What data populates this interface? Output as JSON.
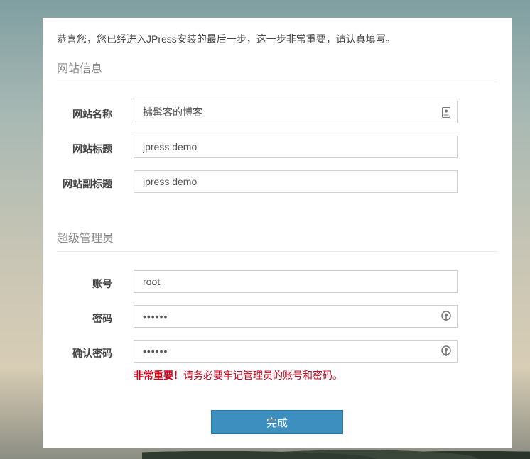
{
  "intro_text": "恭喜您，您已经进入JPress安装的最后一步，这一步非常重要，请认真填写。",
  "site_section": {
    "title": "网站信息",
    "site_name_label": "网站名称",
    "site_name_value": "拂髯客的博客",
    "site_title_label": "网站标题",
    "site_title_value": "jpress demo",
    "site_subtitle_label": "网站副标题",
    "site_subtitle_value": "jpress demo"
  },
  "admin_section": {
    "title": "超级管理员",
    "account_label": "账号",
    "account_value": "root",
    "password_label": "密码",
    "password_value": "••••••",
    "confirm_label": "确认密码",
    "confirm_value": "••••••",
    "hint_strong": "非常重要！",
    "hint_text": "请务必要牢记管理员的账号和密码。"
  },
  "submit_label": "完成",
  "colors": {
    "primary_button": "#3d8fbf",
    "hint_red": "#d0021b"
  },
  "icons": {
    "site_name_field_icon": "contact-card-icon",
    "password_field_icon": "key-icon",
    "confirm_field_icon": "key-icon"
  }
}
